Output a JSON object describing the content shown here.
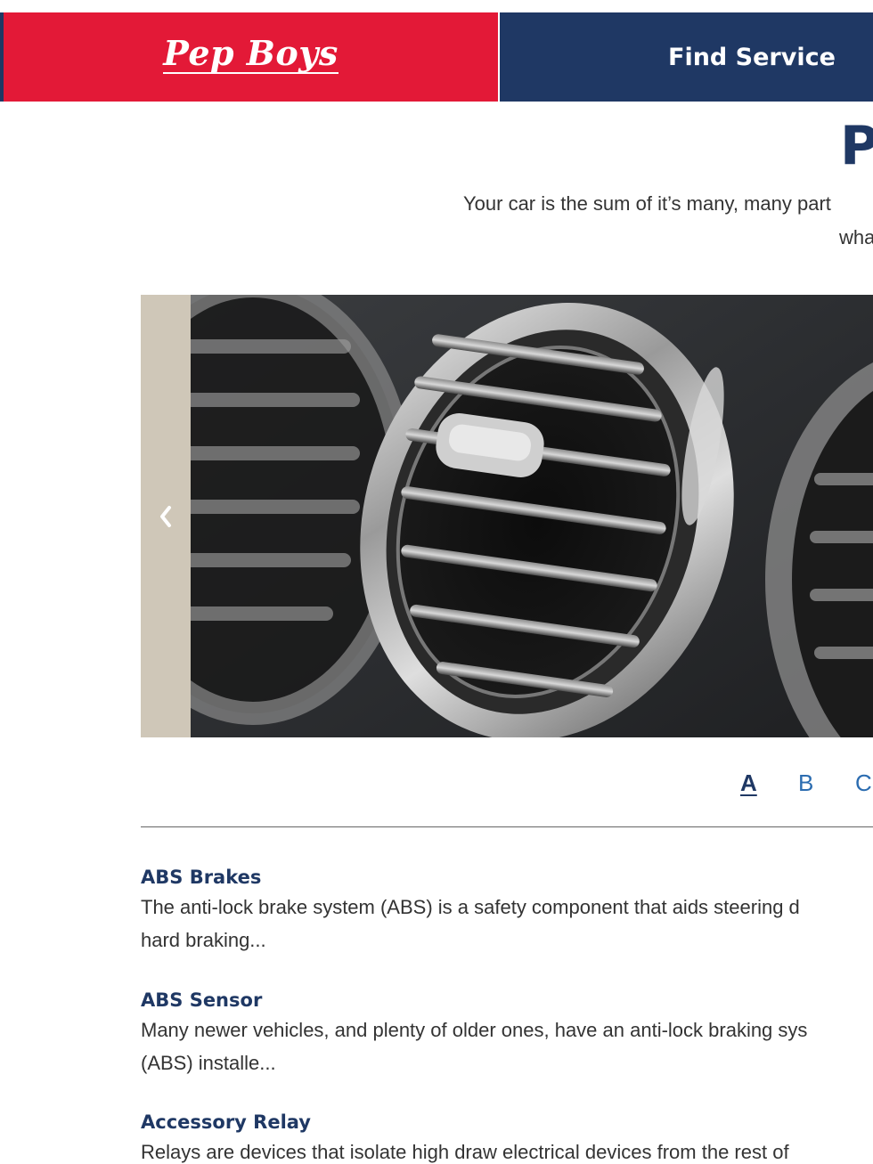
{
  "header": {
    "logo_text": "Pep Boys",
    "nav_find_service": "Find Service"
  },
  "page": {
    "title_partial": "P",
    "intro_line1": "Your car is the sum of it’s many, many part",
    "intro_line2": "wha"
  },
  "carousel": {
    "prev_icon": "chevron-left-icon",
    "image_subject": "car dashboard air vents",
    "colors": {
      "prev_bg": "#cfc7b8",
      "image_dark": "#2a2c2f"
    }
  },
  "alphabet": {
    "letters": [
      "A",
      "B",
      "C"
    ],
    "active": "A"
  },
  "parts": [
    {
      "title": "ABS Brakes",
      "desc_line1": "The anti-lock brake system (ABS) is a safety component that aids steering d",
      "desc_line2": "hard braking..."
    },
    {
      "title": "ABS Sensor",
      "desc_line1": "Many newer vehicles, and plenty of older ones, have an anti-lock braking sys",
      "desc_line2": "(ABS) installe..."
    },
    {
      "title": "Accessory Relay",
      "desc_line1": "Relays are devices that isolate high draw electrical devices from the rest of",
      "desc_line2": ""
    }
  ],
  "colors": {
    "brand_red": "#e31937",
    "brand_navy": "#1f3864",
    "link_blue": "#2b6cb0"
  }
}
